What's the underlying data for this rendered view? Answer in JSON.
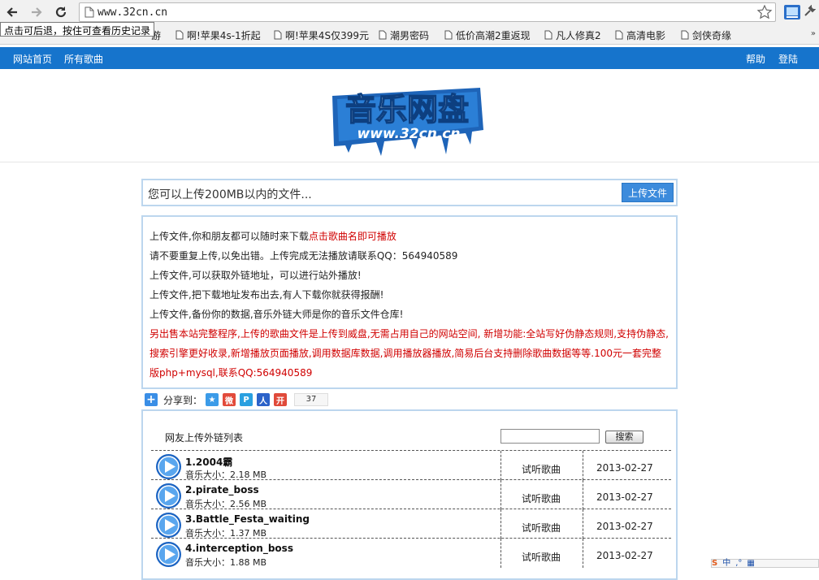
{
  "browser": {
    "url": "www.32cn.cn",
    "tooltip": "点击可后退，按住可查看历史记录",
    "bookmarks": [
      "游",
      "啊!苹果4s-1折起",
      "啊!苹果4S仅399元",
      "潮男密码",
      "低价高潮2重返现",
      "凡人修真2",
      "高清电影",
      "剑侠奇缘"
    ],
    "more": "»"
  },
  "nav": {
    "home": "网站首页",
    "all_songs": "所有歌曲",
    "help": "帮助",
    "login": "登陆"
  },
  "logo": {
    "title": "音乐网盘",
    "domain": "www.32cn.cn"
  },
  "upload": {
    "placeholder": "您可以上传200MB以内的文件...",
    "button": "上传文件"
  },
  "notice": {
    "line1_prefix": "上传文件,你和朋友都可以随时来下载",
    "line1_red": "点击歌曲名即可播放",
    "line2": "请不要重复上传,以免出错。上传完成无法播放请联系QQ：564940589",
    "line3": "上传文件,可以获取外链地址，可以进行站外播放!",
    "line4": "上传文件,把下载地址发布出去,有人下载你就获得报酬!",
    "line5": "上传文件,备份你的数据,音乐外链大师是你的音乐文件仓库!",
    "red_line1": "另出售本站完整程序,上传的歌曲文件是上传到威盘,无需占用自己的网站空间, 新增功能:全站写好伪静态规则,支持伪静态,",
    "red_line2": "搜索引擎更好收录,新增播放页面播放,调用数据库数据,调用播放器播放,简易后台支持删除歌曲数据等等.100元一套完整",
    "red_line3": "版php+mysql,联系QQ:564940589"
  },
  "share": {
    "label": "分享到：",
    "count": "37"
  },
  "list": {
    "title": "网友上传外链列表",
    "search_button": "搜索",
    "rows": [
      {
        "name": "1.2004霸",
        "size": "音乐大小：2.18 MB",
        "action": "试听歌曲",
        "date": "2013-02-27"
      },
      {
        "name": "2.pirate_boss",
        "size": "音乐大小：2.56 MB",
        "action": "试听歌曲",
        "date": "2013-02-27"
      },
      {
        "name": "3.Battle_Festa_waiting",
        "size": "音乐大小：1.37 MB",
        "action": "试听歌曲",
        "date": "2013-02-27"
      },
      {
        "name": "4.interception_boss",
        "size": "音乐大小：1.88 MB",
        "action": "试听歌曲",
        "date": "2013-02-27"
      }
    ]
  },
  "ime": {
    "lang": "中"
  },
  "colors": {
    "nav_blue": "#1674cc",
    "accent_blue": "#3c8bdc",
    "red": "#d00000",
    "border_blue": "#bcd6ee"
  }
}
